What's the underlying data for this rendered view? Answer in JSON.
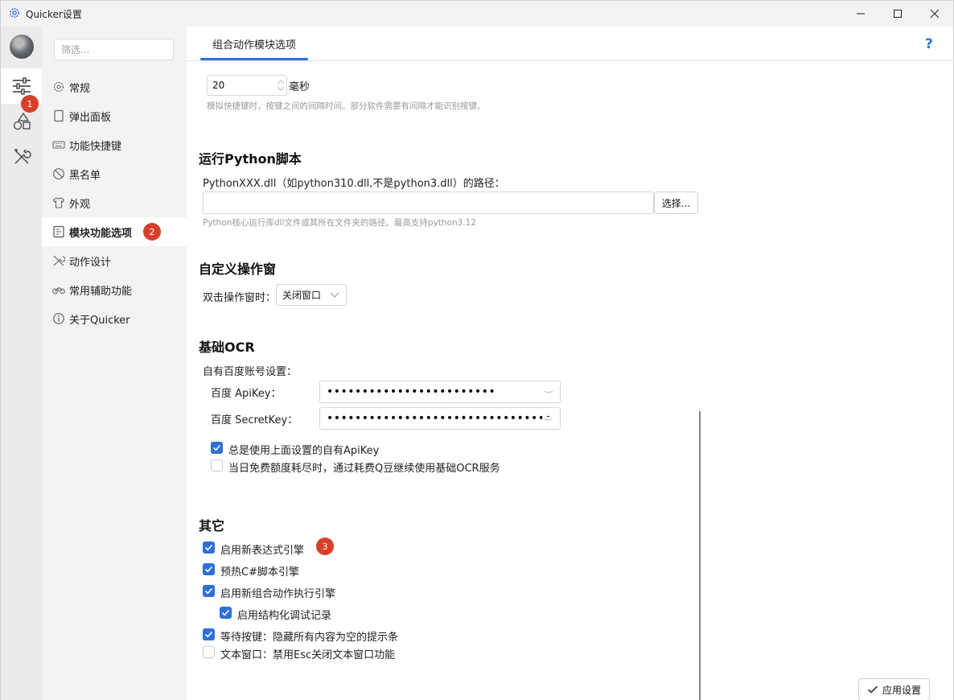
{
  "window": {
    "title": "Quicker设置"
  },
  "rail": {
    "badge": "1"
  },
  "sidebar": {
    "filter_placeholder": "筛选...",
    "items": [
      {
        "label": "常规",
        "icon": "gear-icon"
      },
      {
        "label": "弹出面板",
        "icon": "panel-icon"
      },
      {
        "label": "功能快捷键",
        "icon": "keyboard-icon"
      },
      {
        "label": "黑名单",
        "icon": "block-icon"
      },
      {
        "label": "外观",
        "icon": "shirt-icon"
      },
      {
        "label": "模块功能选项",
        "icon": "module-icon"
      },
      {
        "label": "动作设计",
        "icon": "tools-icon"
      },
      {
        "label": "常用辅助功能",
        "icon": "bike-icon"
      },
      {
        "label": "关于Quicker",
        "icon": "info-icon"
      }
    ],
    "active_badge": "2"
  },
  "main": {
    "tab_label": "组合动作模块选项",
    "help_label": "?",
    "delay": {
      "value": "20",
      "unit": "毫秒",
      "hint": "模拟快捷键时，按键之间的间隔时间。部分软件需要有间隔才能识别按键。"
    },
    "python": {
      "title": "运行Python脚本",
      "path_label": "PythonXXX.dll（如python310.dll,不是python3.dll）的路径：",
      "path_value": "",
      "browse_label": "选择...",
      "hint": "Python核心运行库dll文件或其所在文件夹的路径。最高支持python3.12"
    },
    "custom_window": {
      "title": "自定义操作窗",
      "dblclick_label": "双击操作窗时：",
      "dblclick_value": "关闭窗口"
    },
    "ocr": {
      "title": "基础OCR",
      "account_label": "自有百度账号设置：",
      "apikey_label": "百度 ApiKey：",
      "apikey_value": "••••••••••••••••••••••••",
      "secret_label": "百度 SecretKey：",
      "secret_value": "••••••••••••••••••••••••••••••••",
      "always_use_label": "总是使用上面设置的自有ApiKey",
      "always_use_checked": true,
      "use_qbean_label": "当日免费额度耗尽时，通过耗费Q豆继续使用基础OCR服务",
      "use_qbean_checked": false
    },
    "other": {
      "title": "其它",
      "badge": "3",
      "options": [
        {
          "label": "启用新表达式引擎",
          "checked": true
        },
        {
          "label": "预热C#脚本引擎",
          "checked": true
        },
        {
          "label": "启用新组合动作执行引擎",
          "checked": true
        },
        {
          "label": "启用结构化调试记录",
          "checked": true
        },
        {
          "label": "等待按键：隐藏所有内容为空的提示条",
          "checked": true
        },
        {
          "label": "文本窗口：禁用Esc关闭文本窗口功能",
          "checked": false
        }
      ]
    },
    "apply_label": "应用设置"
  },
  "colors": {
    "accent": "#2f6fd8",
    "badge": "#d6402a"
  }
}
